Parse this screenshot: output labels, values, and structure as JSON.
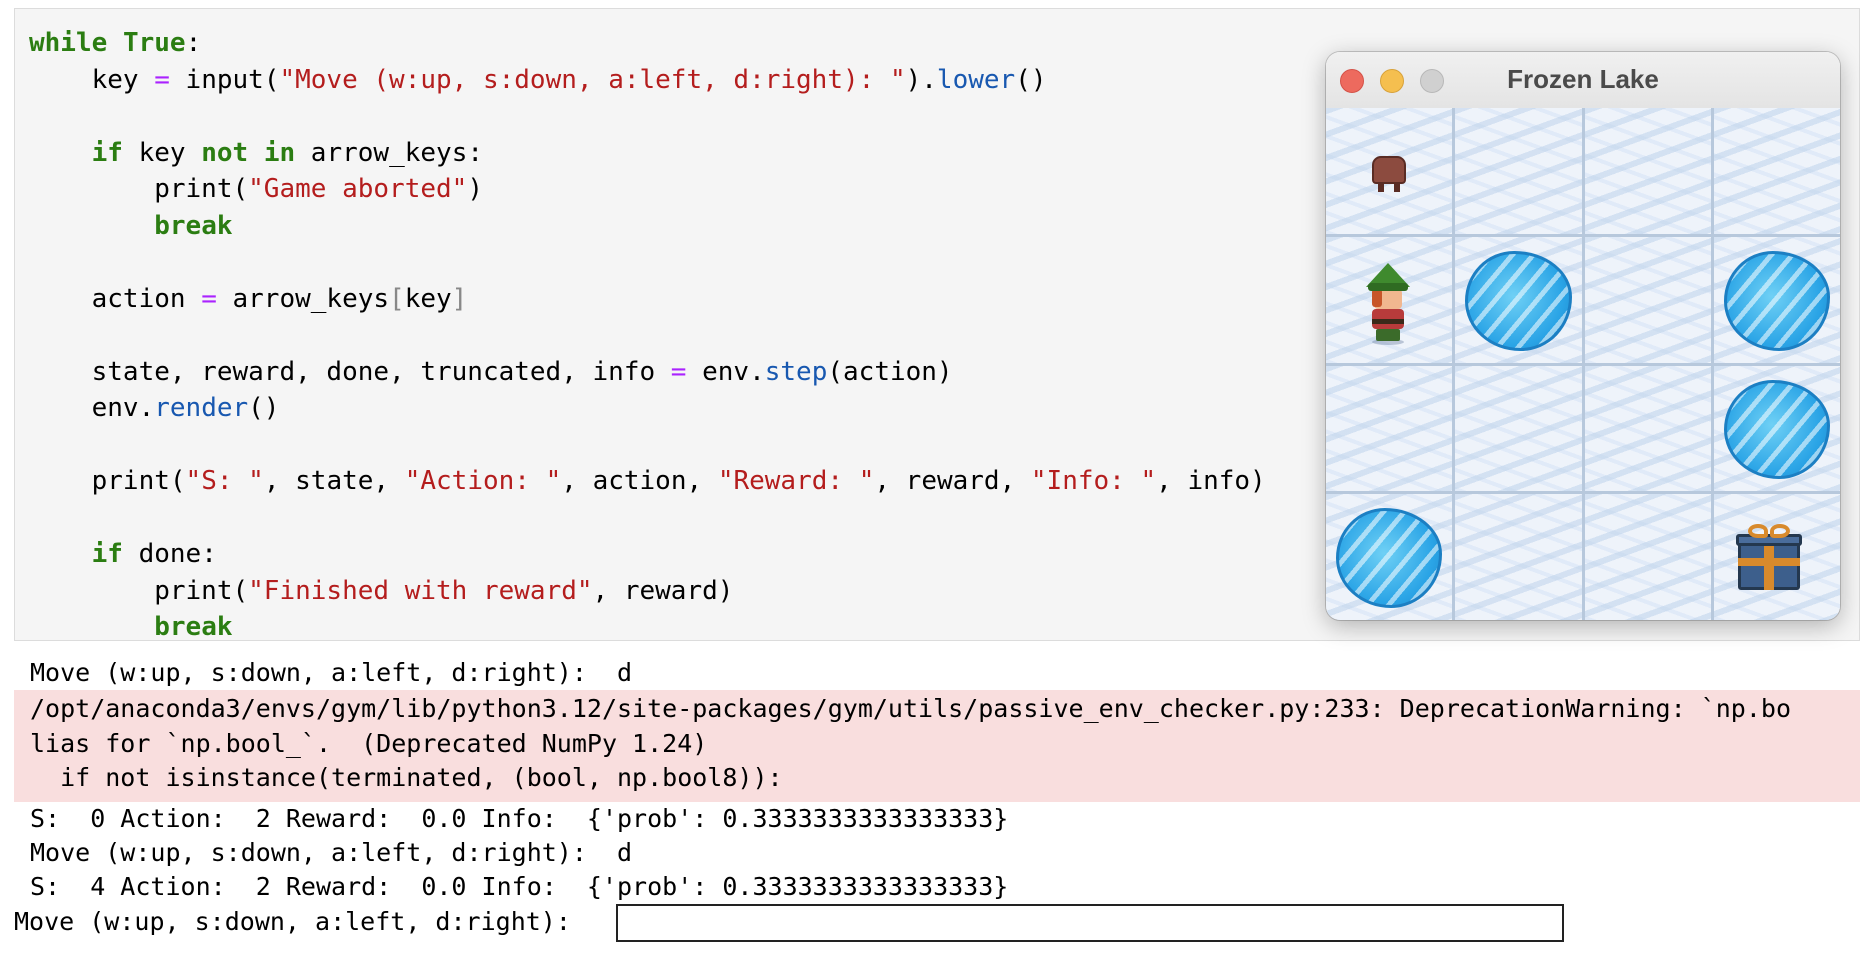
{
  "code_cell": {
    "lines": [
      [
        [
          "kw",
          "while"
        ],
        [
          "txt",
          " "
        ],
        [
          "kw",
          "True"
        ],
        [
          "txt",
          ":"
        ]
      ],
      [
        [
          "txt",
          "    key "
        ],
        [
          "op",
          "="
        ],
        [
          "txt",
          " input("
        ],
        [
          "str",
          "\"Move (w:up, s:down, a:left, d:right): \""
        ],
        [
          "txt",
          ")."
        ],
        [
          "fn",
          "lower"
        ],
        [
          "txt",
          "()"
        ]
      ],
      [],
      [
        [
          "txt",
          "    "
        ],
        [
          "kw",
          "if"
        ],
        [
          "txt",
          " key "
        ],
        [
          "kw",
          "not"
        ],
        [
          "txt",
          " "
        ],
        [
          "kw",
          "in"
        ],
        [
          "txt",
          " arrow_keys:"
        ]
      ],
      [
        [
          "txt",
          "        print("
        ],
        [
          "str",
          "\"Game aborted\""
        ],
        [
          "txt",
          ")"
        ]
      ],
      [
        [
          "txt",
          "        "
        ],
        [
          "kw",
          "break"
        ]
      ],
      [],
      [
        [
          "txt",
          "    action "
        ],
        [
          "op",
          "="
        ],
        [
          "txt",
          " arrow_keys"
        ],
        [
          "br",
          "["
        ],
        [
          "txt",
          "key"
        ],
        [
          "br",
          "]"
        ]
      ],
      [],
      [
        [
          "txt",
          "    state, reward, done, truncated, info "
        ],
        [
          "op",
          "="
        ],
        [
          "txt",
          " env."
        ],
        [
          "fn",
          "step"
        ],
        [
          "txt",
          "(action)"
        ]
      ],
      [
        [
          "txt",
          "    env."
        ],
        [
          "fn",
          "render"
        ],
        [
          "txt",
          "()"
        ]
      ],
      [],
      [
        [
          "txt",
          "    print("
        ],
        [
          "str",
          "\"S: \""
        ],
        [
          "txt",
          ", state, "
        ],
        [
          "str",
          "\"Action: \""
        ],
        [
          "txt",
          ", action, "
        ],
        [
          "str",
          "\"Reward: \""
        ],
        [
          "txt",
          ", reward, "
        ],
        [
          "str",
          "\"Info: \""
        ],
        [
          "txt",
          ", info)"
        ]
      ],
      [],
      [
        [
          "txt",
          "    "
        ],
        [
          "kw",
          "if"
        ],
        [
          "txt",
          " done:"
        ]
      ],
      [
        [
          "txt",
          "        print("
        ],
        [
          "str",
          "\"Finished with reward\""
        ],
        [
          "txt",
          ", reward)"
        ]
      ],
      [
        [
          "txt",
          "        "
        ],
        [
          "kw",
          "break"
        ]
      ]
    ]
  },
  "output": {
    "line1": "Move (w:up, s:down, a:left, d:right):  d",
    "stderr": "/opt/anaconda3/envs/gym/lib/python3.12/site-packages/gym/utils/passive_env_checker.py:233: DeprecationWarning: `np.bo\nlias for `np.bool_`.  (Deprecated NumPy 1.24)\n  if not isinstance(terminated, (bool, np.bool8)):",
    "line2": "S:  0 Action:  2 Reward:  0.0 Info:  {'prob': 0.3333333333333333}",
    "line3": "Move (w:up, s:down, a:left, d:right):  d",
    "line4": "S:  4 Action:  2 Reward:  0.0 Info:  {'prob': 0.3333333333333333}",
    "prompt_label": "Move (w:up, s:down, a:left, d:right): ",
    "prompt_value": ""
  },
  "game_window": {
    "title": "Frozen Lake",
    "grid": [
      [
        "stool",
        "ice",
        "ice",
        "ice"
      ],
      [
        "elf",
        "hole",
        "ice",
        "hole"
      ],
      [
        "ice",
        "ice",
        "ice",
        "hole"
      ],
      [
        "hole",
        "ice",
        "ice",
        "gift"
      ]
    ],
    "colors": {
      "close": "#ed6a5e",
      "minimize": "#f5bf4f",
      "maximize": "#d0d0d0"
    }
  }
}
